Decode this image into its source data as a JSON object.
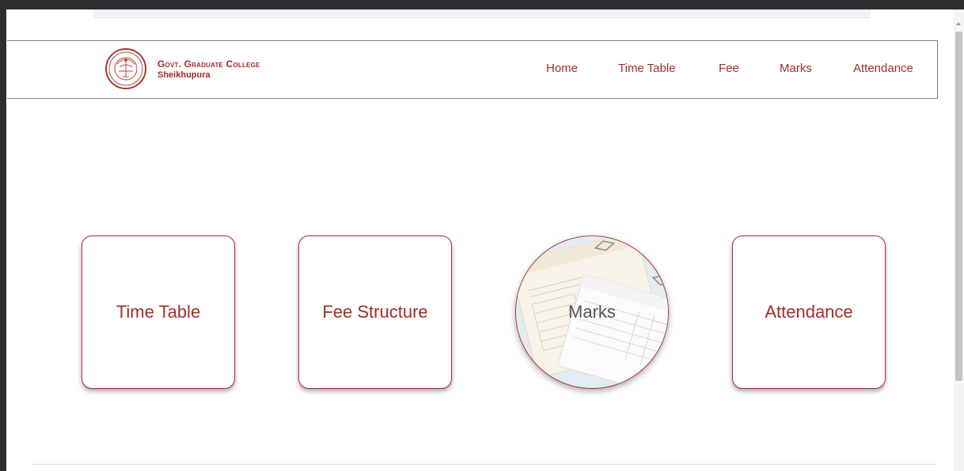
{
  "header": {
    "brand_name": "Govt. Graduate College",
    "brand_city": "Sheikhupura",
    "logo_icon": "college-crest-icon",
    "nav": [
      {
        "label": "Home"
      },
      {
        "label": "Time Table"
      },
      {
        "label": "Fee"
      },
      {
        "label": "Marks"
      },
      {
        "label": "Attendance"
      }
    ]
  },
  "cards": [
    {
      "label": "Time Table"
    },
    {
      "label": "Fee Structure"
    },
    {
      "label": "Marks"
    },
    {
      "label": "Attendance"
    }
  ],
  "colors": {
    "accent": "#a22e2a",
    "frame": "#2e2e2e"
  }
}
